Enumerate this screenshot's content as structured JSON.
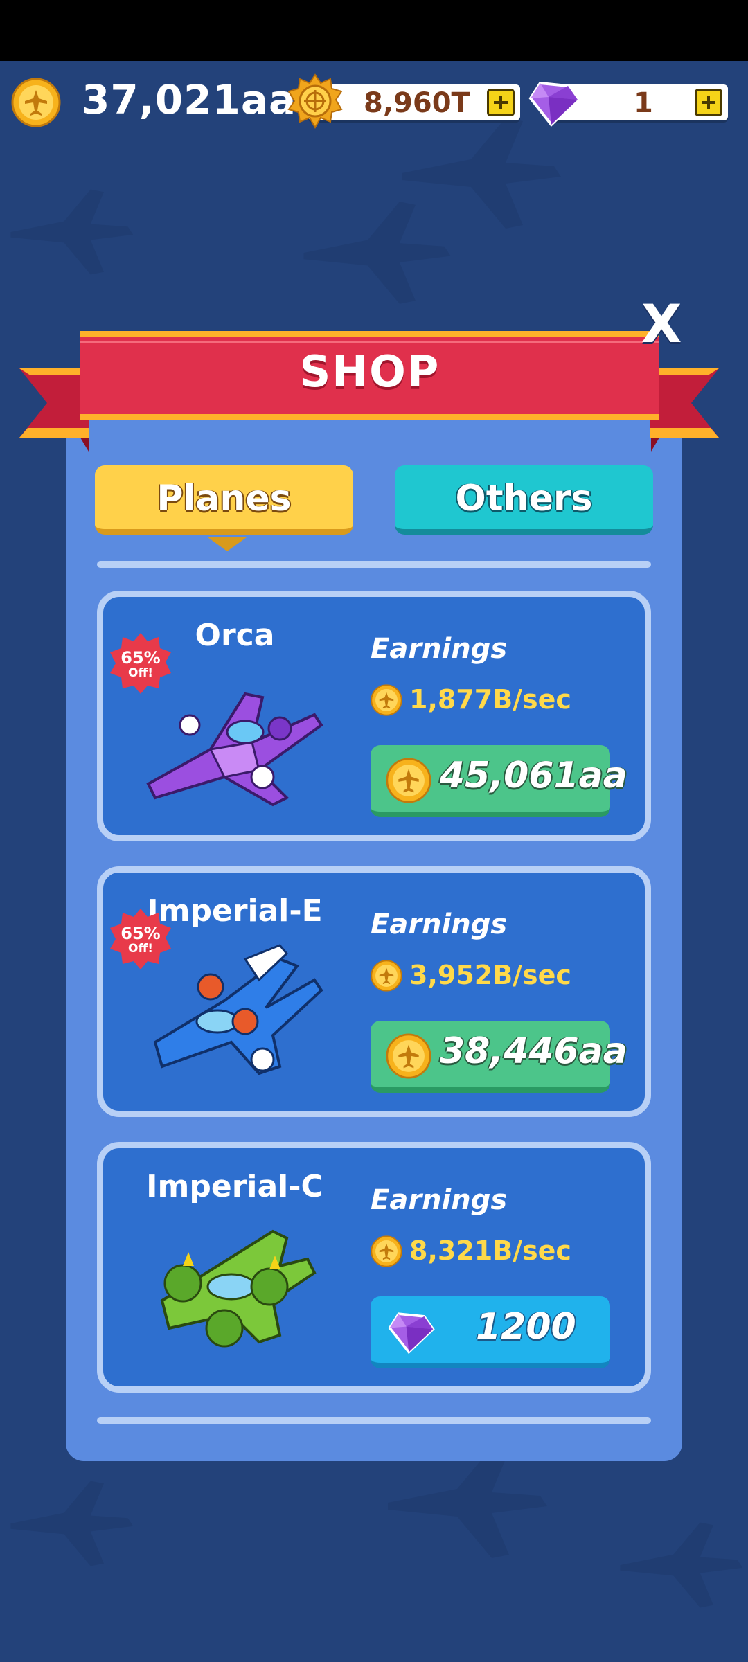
{
  "topbar": {
    "coins": "37,021aa",
    "gold": "8,960T",
    "gems": "1"
  },
  "shop": {
    "title": "SHOP",
    "close_label": "X",
    "tabs": [
      {
        "label": "Planes",
        "active": true
      },
      {
        "label": "Others",
        "active": false
      }
    ],
    "earnings_label": "Earnings",
    "items": [
      {
        "name": "Orca",
        "discount": "65%",
        "discount_sub": "Off!",
        "earnings": "1,877B/sec",
        "price": "45,061aa",
        "currency": "coin",
        "color": "purple"
      },
      {
        "name": "Imperial-E",
        "discount": "65%",
        "discount_sub": "Off!",
        "earnings": "3,952B/sec",
        "price": "38,446aa",
        "currency": "coin",
        "color": "blue"
      },
      {
        "name": "Imperial-C",
        "discount": "",
        "discount_sub": "",
        "earnings": "8,321B/sec",
        "price": "1200",
        "currency": "gem",
        "color": "green"
      }
    ]
  },
  "colors": {
    "background": "#23427a",
    "panel": "#5b8be0",
    "card": "#2e6fcf",
    "ribbon": "#e0304c",
    "tab_active": "#ffd14a",
    "tab_inactive": "#1fc7d0",
    "buy_coin": "#4cc58a",
    "buy_gem": "#20b2ec",
    "earnings_text": "#ffd94a"
  }
}
